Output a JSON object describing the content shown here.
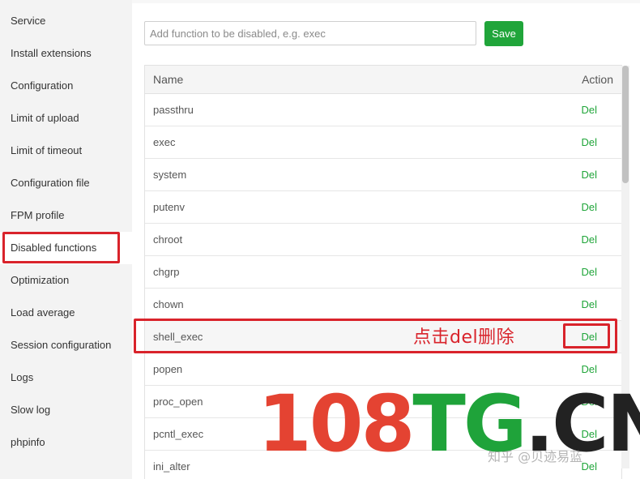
{
  "sidebar": {
    "items": [
      {
        "label": "Service"
      },
      {
        "label": "Install extensions"
      },
      {
        "label": "Configuration"
      },
      {
        "label": "Limit of upload"
      },
      {
        "label": "Limit of timeout"
      },
      {
        "label": "Configuration file"
      },
      {
        "label": "FPM profile"
      },
      {
        "label": "Disabled functions",
        "active": true
      },
      {
        "label": "Optimization"
      },
      {
        "label": "Load average"
      },
      {
        "label": "Session configuration"
      },
      {
        "label": "Logs"
      },
      {
        "label": "Slow log"
      },
      {
        "label": "phpinfo"
      }
    ]
  },
  "form": {
    "input_value": "",
    "input_placeholder": "Add function to be disabled, e.g. exec",
    "save_label": "Save"
  },
  "table": {
    "columns": [
      "Name",
      "Action"
    ],
    "rows": [
      {
        "name": "passthru",
        "action": "Del"
      },
      {
        "name": "exec",
        "action": "Del"
      },
      {
        "name": "system",
        "action": "Del"
      },
      {
        "name": "putenv",
        "action": "Del"
      },
      {
        "name": "chroot",
        "action": "Del"
      },
      {
        "name": "chgrp",
        "action": "Del"
      },
      {
        "name": "chown",
        "action": "Del"
      },
      {
        "name": "shell_exec",
        "action": "Del",
        "highlighted": true
      },
      {
        "name": "popen",
        "action": "Del"
      },
      {
        "name": "proc_open",
        "action": "Del"
      },
      {
        "name": "pcntl_exec",
        "action": "Del"
      },
      {
        "name": "ini_alter",
        "action": "Del"
      }
    ]
  },
  "annotation": {
    "text": "点击del删除",
    "color": "#d9232b"
  },
  "watermark": {
    "part1": "108",
    "part2": "TG",
    "part3": ".CN",
    "colors": [
      "#e44332",
      "#1fa33a",
      "#222222"
    ],
    "credit": "知乎 @贝迹易蓝"
  },
  "colors": {
    "accent": "#20a53a",
    "highlight_box": "#d9232b"
  }
}
